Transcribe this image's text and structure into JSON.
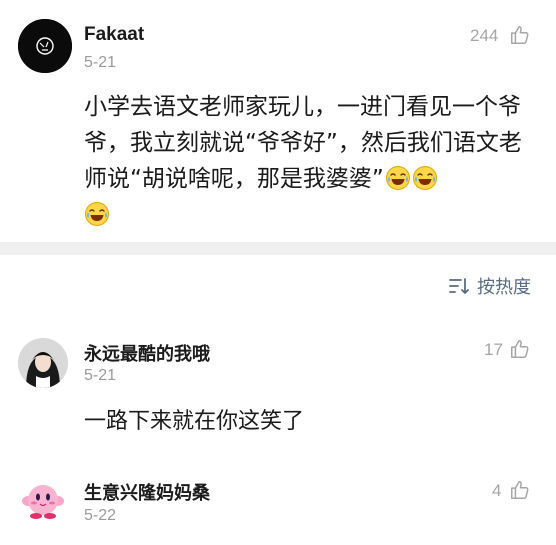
{
  "post": {
    "author": "Fakaat",
    "date": "5-21",
    "likes": "244",
    "text": "小学去语文老师家玩儿，一进门看见一个爷爷，我立刻就说“爷爷好”，然后我们语文老师说“胡说啥呢，那是我婆婆”",
    "emoji": "laughing-crying-emoji",
    "emoji_count": 3
  },
  "sort": {
    "label": "按热度",
    "icon": "sort-icon"
  },
  "comments": [
    {
      "author": "永远最酷的我哦",
      "date": "5-21",
      "likes": "17",
      "text": "一路下来就在你这笑了"
    },
    {
      "author": "生意兴隆妈妈桑",
      "date": "5-22",
      "likes": "4",
      "text": ""
    }
  ],
  "colors": {
    "divider": "#f0f0f0",
    "muted": "#9a9a9a",
    "sort": "#5a6b80"
  }
}
